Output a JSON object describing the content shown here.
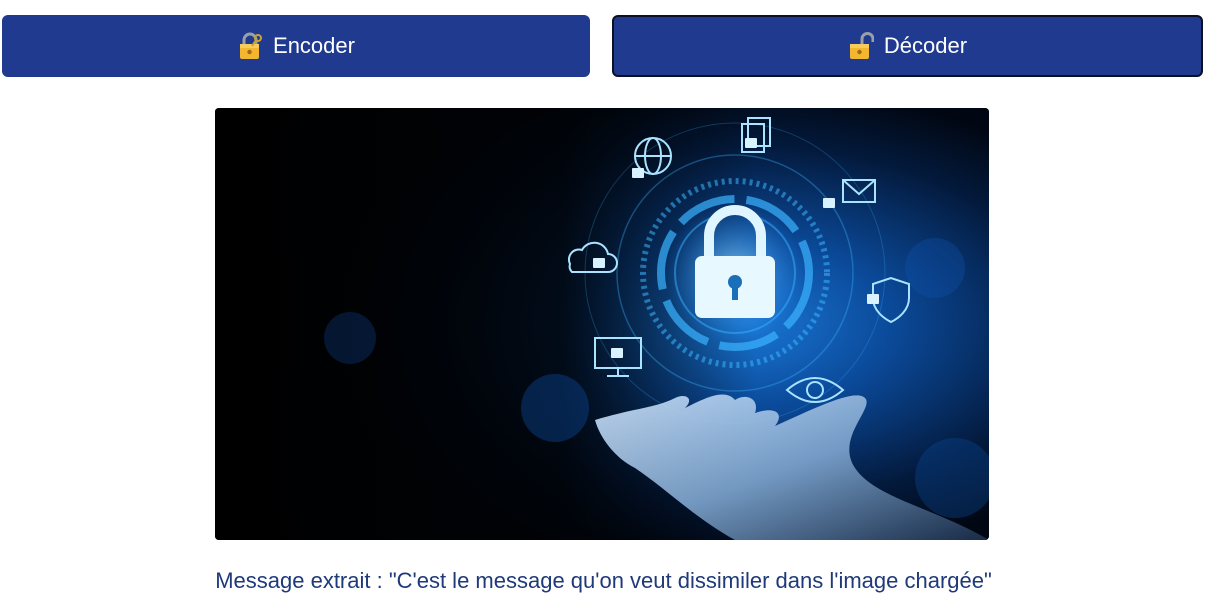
{
  "toolbar": {
    "encode_label": "Encoder",
    "decode_label": "Décoder",
    "encode_icon": "locked-with-key-icon",
    "decode_icon": "unlocked-padlock-icon"
  },
  "colors": {
    "button_bg": "#1f3a8f",
    "button_text": "#ffffff",
    "message_text": "#1f3a7a"
  },
  "image": {
    "description_icon": "cybersecurity-padlock-hand-image"
  },
  "result": {
    "message": "Message extrait : \"C'est le message qu'on veut dissimiler dans l'image chargée\""
  }
}
